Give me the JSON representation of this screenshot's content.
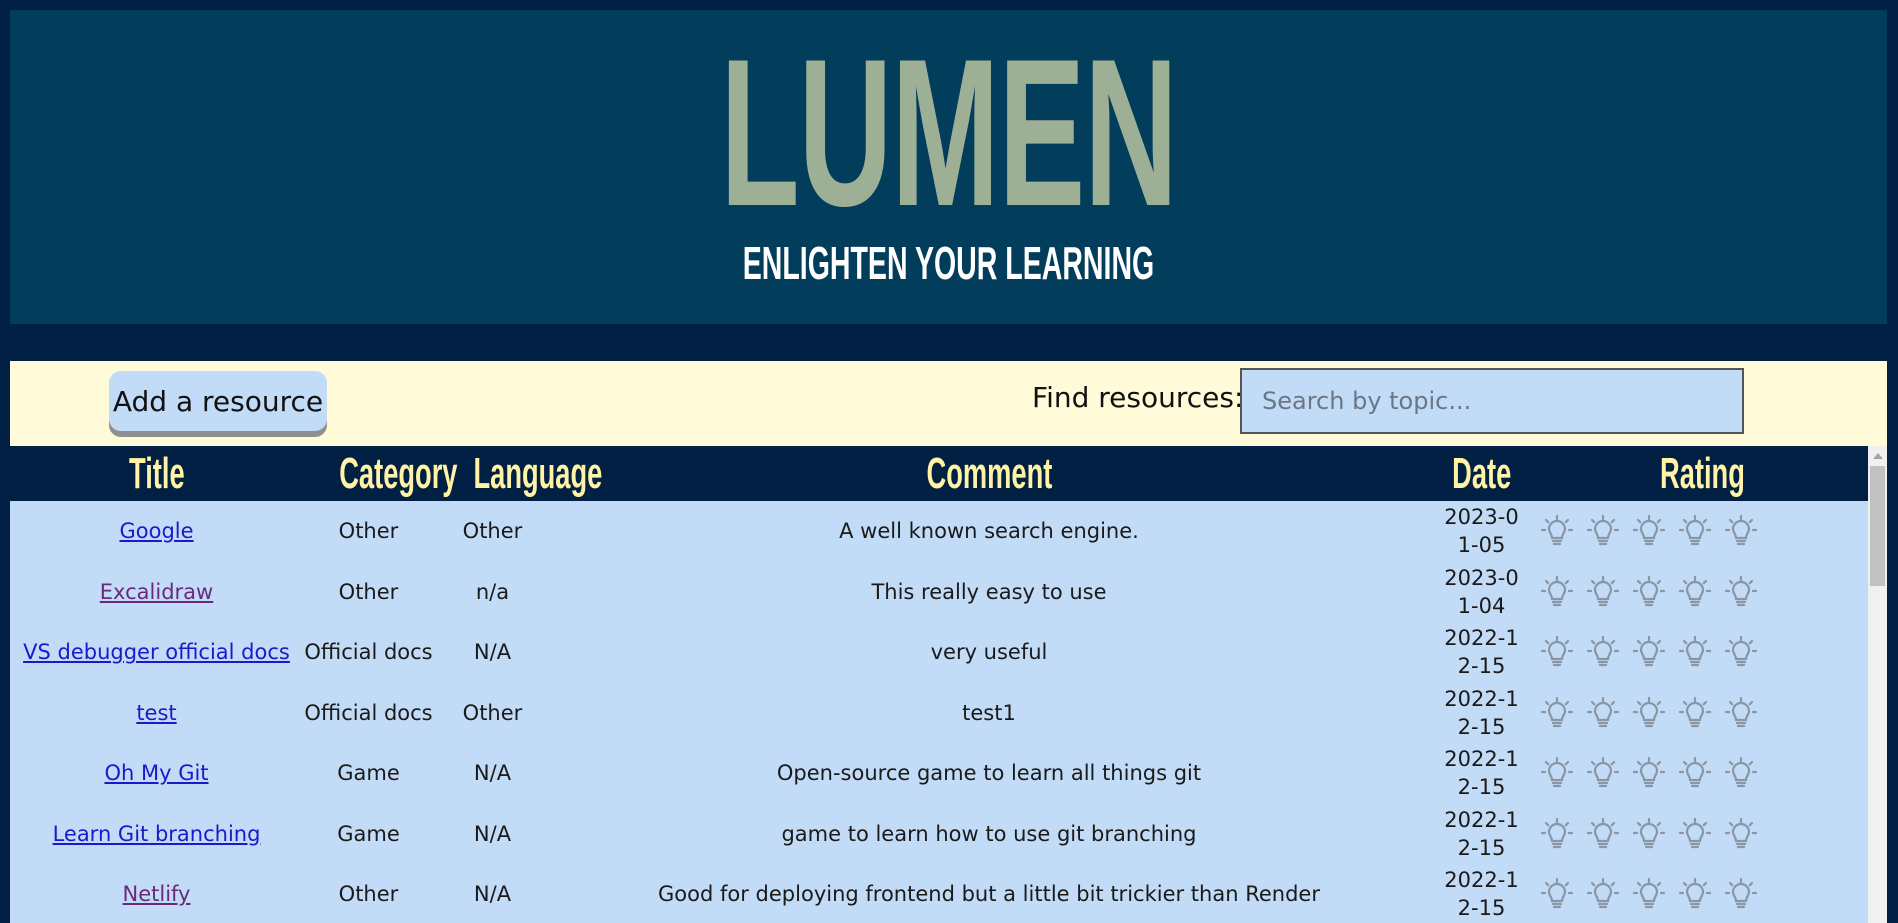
{
  "header": {
    "logo": "LUMEN",
    "tagline": "ENLIGHTEN YOUR LEARNING"
  },
  "toolbar": {
    "add_label": "Add a resource",
    "find_label": "Find resources:",
    "search_placeholder": "Search by topic..."
  },
  "table": {
    "headers": [
      "Title",
      "Category",
      "Language",
      "Comment",
      "Date",
      "Rating"
    ],
    "rows": [
      {
        "title": "Google",
        "category": "Other",
        "language": "Other",
        "comment": "A well known search engine.",
        "date": "2023-01-05",
        "visited": false
      },
      {
        "title": "Excalidraw",
        "category": "Other",
        "language": "n/a",
        "comment": "This really easy to use",
        "date": "2023-01-04",
        "visited": true
      },
      {
        "title": "VS debugger official docs",
        "category": "Official docs",
        "language": "N/A",
        "comment": "very useful",
        "date": "2022-12-15",
        "visited": false
      },
      {
        "title": "test",
        "category": "Official docs",
        "language": "Other",
        "comment": "test1",
        "date": "2022-12-15",
        "visited": false
      },
      {
        "title": "Oh My Git",
        "category": "Game",
        "language": "N/A",
        "comment": "Open-source game to learn all things git",
        "date": "2022-12-15",
        "visited": false
      },
      {
        "title": "Learn Git branching",
        "category": "Game",
        "language": "N/A",
        "comment": "game to learn how to use git branching",
        "date": "2022-12-15",
        "visited": false
      },
      {
        "title": "Netlify",
        "category": "Other",
        "language": "N/A",
        "comment": "Good for deploying frontend but a little bit trickier than Render",
        "date": "2022-12-15",
        "visited": true
      }
    ],
    "rating_icon": "lightbulb-icon",
    "rating_max": 5
  },
  "colors": {
    "background": "#021f44",
    "header_bg": "#033d5c",
    "logo": "#9db095",
    "toolbar_bg": "#fffbd9",
    "row_bg": "#c2dbf7",
    "header_text": "#fff3a6",
    "bulb": "#8a96a4"
  }
}
